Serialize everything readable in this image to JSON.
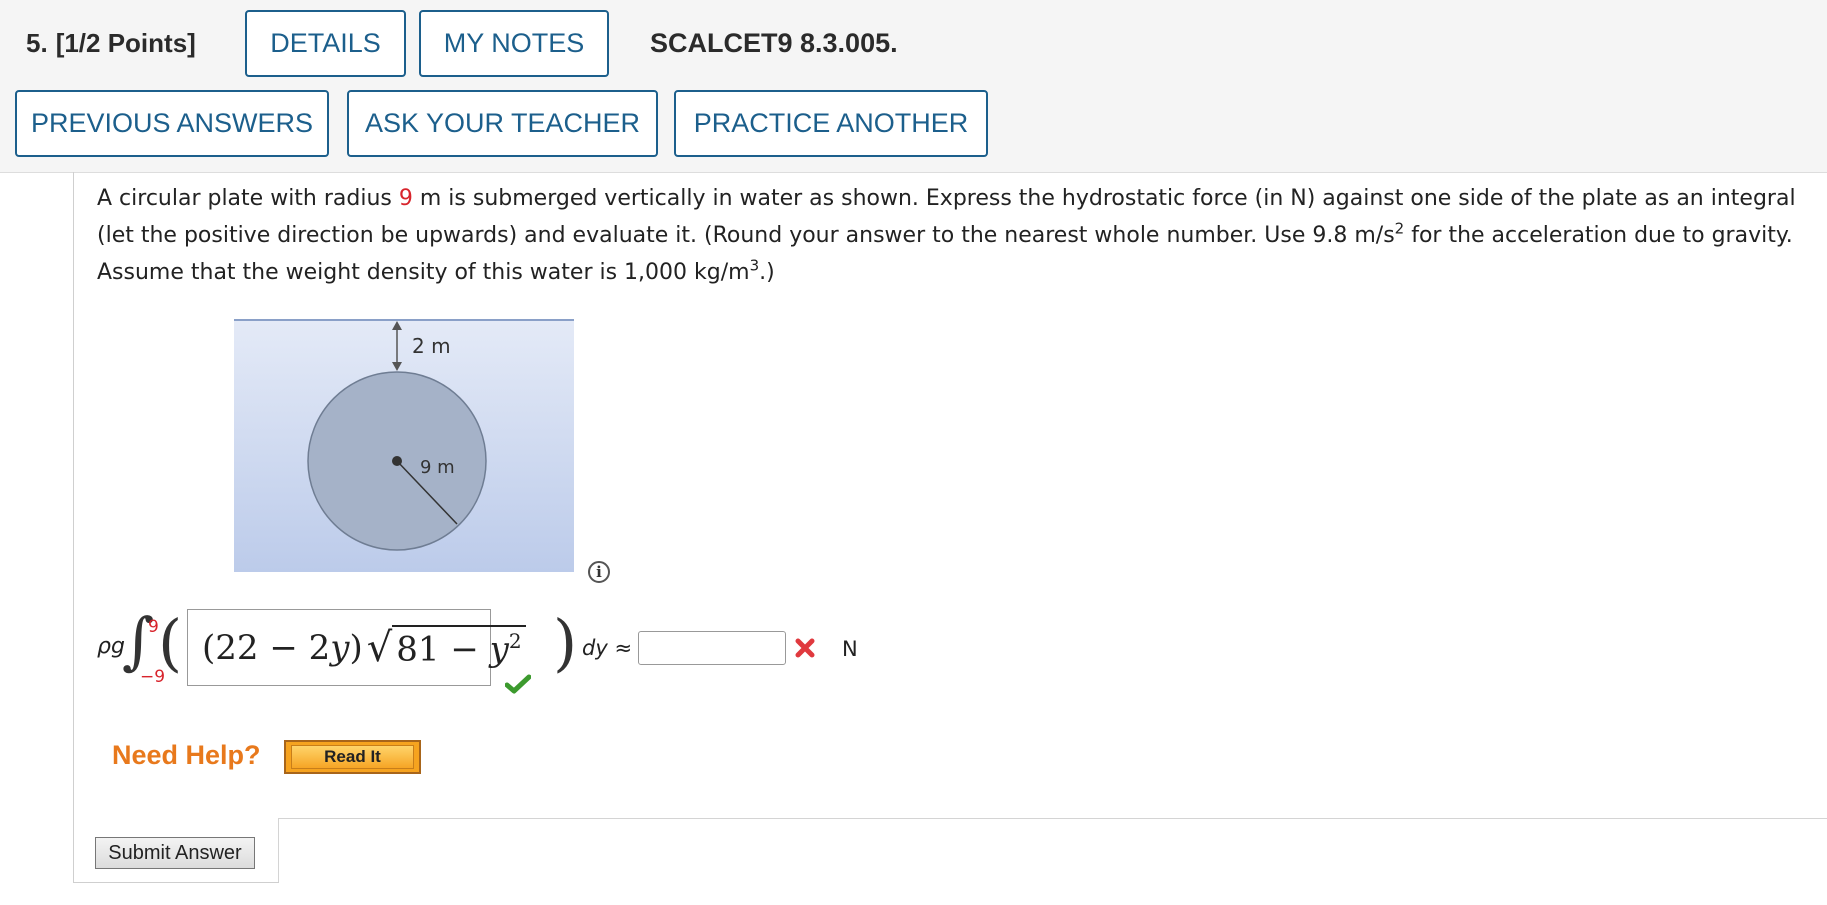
{
  "header": {
    "question_number": "5.",
    "points": "[1/2 Points]",
    "buttons": {
      "details": "DETAILS",
      "my_notes": "MY NOTES"
    },
    "problem_code": "SCALCET9 8.3.005.",
    "buttons_row2": {
      "previous_answers": "PREVIOUS ANSWERS",
      "ask_teacher": "ASK YOUR TEACHER",
      "practice_another": "PRACTICE ANOTHER"
    }
  },
  "question": {
    "text_1": "A circular plate with radius ",
    "radius": "9",
    "text_2": " m is submerged vertically in water as shown. Express the hydrostatic force (in N) against one side of the plate as an integral (let the positive direction be upwards) and evaluate it. (Round your answer to the nearest whole number. Use 9.8 m/s",
    "exp_2": "2",
    "text_3": " for the acceleration due to gravity. Assume that the weight density of this water is 1,000 kg/m",
    "exp_3": "3",
    "text_4": ".)"
  },
  "figure": {
    "depth_label": "2 m",
    "radius_label": "9 m"
  },
  "answer": {
    "rho_g": "ρg",
    "integral_sign": "∫",
    "upper_limit": "9",
    "lower_limit": "−9",
    "lparen": "(",
    "rparen": ")",
    "expr_part": "(22 − 2",
    "expr_var": "y",
    "expr_close": ")",
    "sqrt": "√",
    "radicand_base": "81 − ",
    "radicand_var": "y",
    "radicand_exp": "2",
    "expr_status": "correct",
    "dy_label": "dy",
    "approx": "≈",
    "final_value": "",
    "final_status": "incorrect",
    "unit": "N"
  },
  "help": {
    "label": "Need Help?",
    "read_it": "Read It"
  },
  "submit_label": "Submit Answer",
  "icons": {
    "info": "info-icon",
    "check": "check-icon",
    "cross": "x-icon"
  },
  "colors": {
    "accent": "#1c5f8c",
    "red": "#d8242c",
    "orange": "#e8791c",
    "green": "#3c9a2e"
  }
}
